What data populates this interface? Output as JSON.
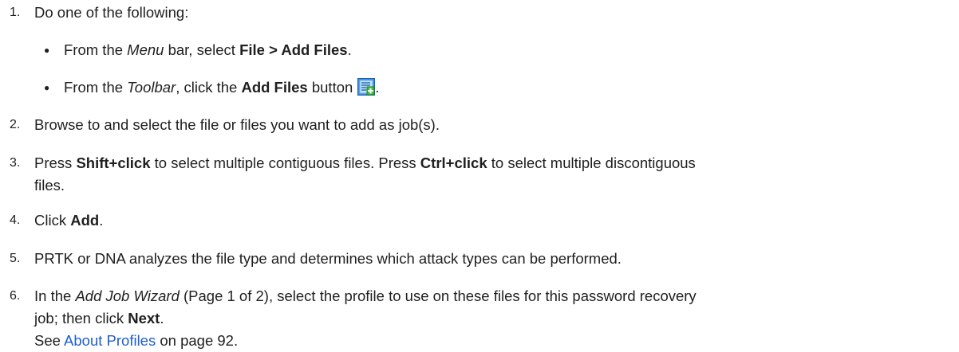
{
  "steps": [
    {
      "num": "1.",
      "text": "Do one of the following:"
    },
    {
      "num": "2.",
      "text": "Browse to and select the file or files you want to add as job(s)."
    },
    {
      "num": "3.",
      "pre1": "Press ",
      "b1": "Shift+click",
      "mid": " to select multiple contiguous files. Press ",
      "b2": "Ctrl+click",
      "post_line1": " to select multiple discontiguous",
      "line2": "files."
    },
    {
      "num": "4.",
      "pre": "Click ",
      "bold": "Add",
      "post": "."
    },
    {
      "num": "5.",
      "text": "PRTK or DNA analyzes the file type and determines which attack types can be performed."
    },
    {
      "num": "6.",
      "pre": "In the ",
      "italic": "Add Job Wizard",
      "line1_rest": " (Page 1 of 2), select the profile to use on these files for this password recovery",
      "line2_pre": "job; then click ",
      "line2_bold": "Next",
      "line2_post": ".",
      "see_pre": "See ",
      "see_link": "About Profiles",
      "see_post": " on page 92."
    }
  ],
  "bullets": [
    {
      "pre": "From the ",
      "italic": "Menu",
      "mid": " bar, select ",
      "bold": "File > Add Files",
      "post": "."
    },
    {
      "pre": "From the ",
      "italic": "Toolbar",
      "mid": ", click the ",
      "bold": "Add Files",
      "post": " button",
      "icon": "add-files-icon",
      "tail": "."
    }
  ],
  "bullet_char": "●"
}
